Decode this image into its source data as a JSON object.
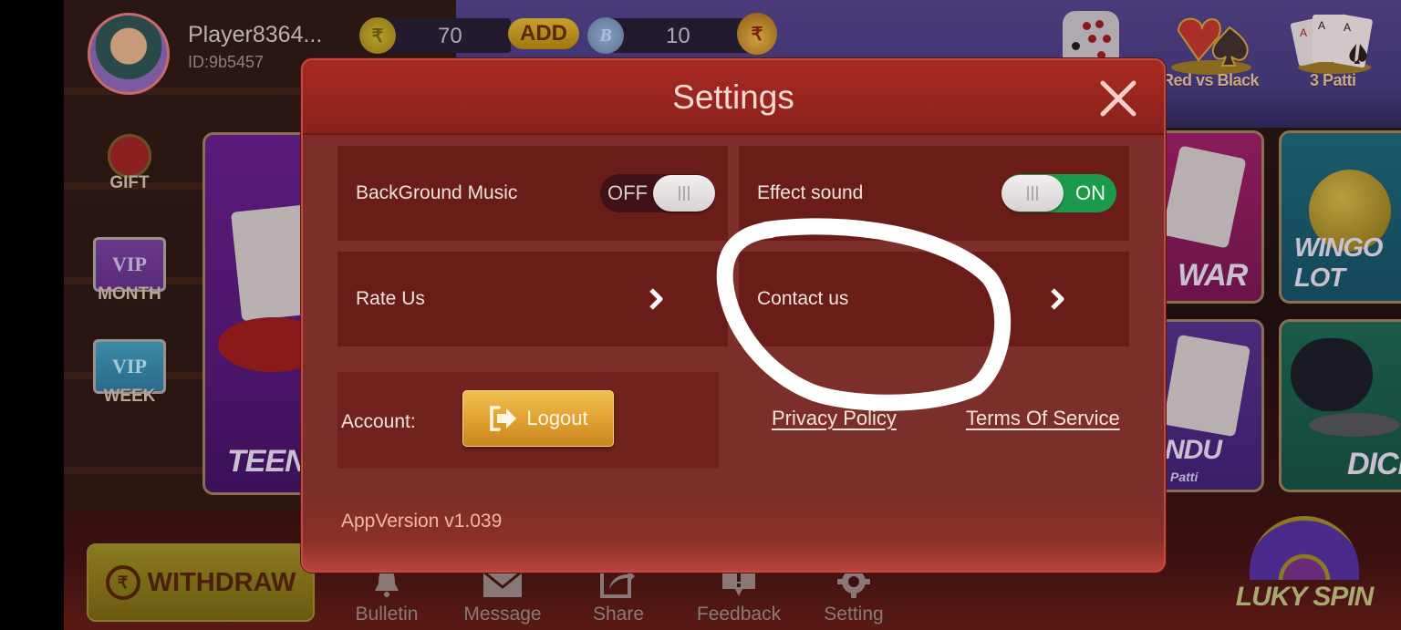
{
  "player": {
    "name": "Player8364...",
    "id": "ID:9b5457"
  },
  "wallet": {
    "cash_balance": "70",
    "add_label": "ADD",
    "bonus_balance": "10",
    "bonus_symbol": "B",
    "rupee_symbol": "₹"
  },
  "top_games": [
    {
      "label": ""
    },
    {
      "label": "Red vs Black"
    },
    {
      "label": "3 Patti"
    }
  ],
  "side_menu": [
    {
      "label": "GIFT"
    },
    {
      "label": "MONTH",
      "badge": "VIP"
    },
    {
      "label": "WEEK",
      "badge": "VIP"
    }
  ],
  "game_tiles": [
    {
      "label": "TEEN"
    },
    {
      "label": "WAR"
    },
    {
      "label": "WINGO LOT"
    },
    {
      "label": "NDU",
      "sub": "Patti"
    },
    {
      "label": "DICE"
    }
  ],
  "withdraw": {
    "label": "WITHDRAW"
  },
  "bottom_nav": [
    {
      "label": "Bulletin"
    },
    {
      "label": "Message"
    },
    {
      "label": "Share"
    },
    {
      "label": "Feedback"
    },
    {
      "label": "Setting"
    }
  ],
  "luky_spin": {
    "label": "LUKY SPIN"
  },
  "settings": {
    "title": "Settings",
    "background_music": {
      "label": "BackGround Music",
      "state": "OFF"
    },
    "effect_sound": {
      "label": "Effect sound",
      "state": "ON"
    },
    "rate_us": {
      "label": "Rate Us"
    },
    "contact_us": {
      "label": "Contact us"
    },
    "account_label": "Account:",
    "logout_label": "Logout",
    "privacy_policy": "Privacy Policy",
    "terms_of_service": "Terms Of Service",
    "app_version": "AppVersion v1.039"
  },
  "colors": {
    "modal_bg": "#7c2e2a",
    "card_bg": "#6a1c18",
    "toggle_on": "#1a9a4a",
    "toggle_off": "#3e1216",
    "logout_gold": "#e0a030",
    "title_text": "#f8d8d0"
  }
}
